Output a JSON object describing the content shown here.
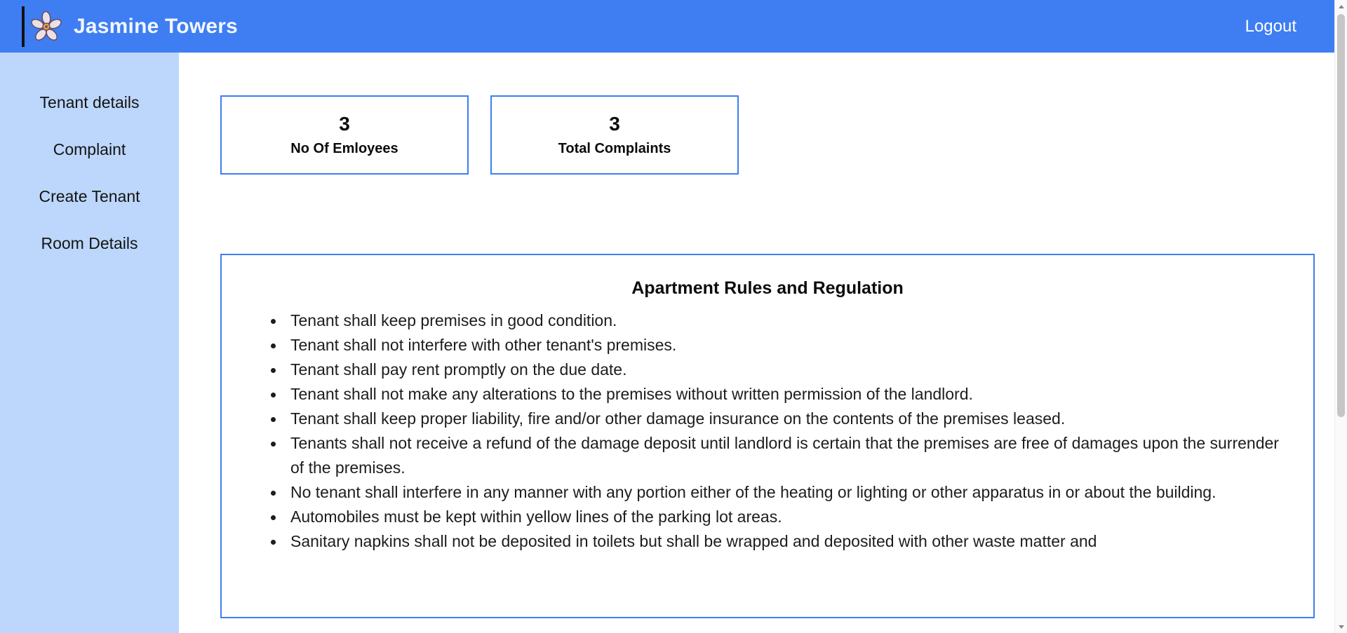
{
  "header": {
    "brand_title": "Jasmine Towers",
    "logo_icon": "jasmine-flower-icon",
    "logout_label": "Logout",
    "background_color": "#3e7ef2"
  },
  "sidebar": {
    "background_color": "#bcd7fb",
    "items": [
      {
        "label": "Tenant details"
      },
      {
        "label": "Complaint"
      },
      {
        "label": "Create Tenant"
      },
      {
        "label": "Room Details"
      }
    ]
  },
  "stats": {
    "accent_color": "#3e7ef2",
    "cards": [
      {
        "value": "3",
        "label": "No Of Emloyees"
      },
      {
        "value": "3",
        "label": "Total Complaints"
      }
    ]
  },
  "rules": {
    "title": "Apartment Rules and Regulation",
    "items": [
      "Tenant shall keep premises in good condition.",
      "Tenant shall not interfere with other tenant's premises.",
      "Tenant shall pay rent promptly on the due date.",
      "Tenant shall not make any alterations to the premises without written permission of the landlord.",
      "Tenant shall keep proper liability, fire and/or other damage insurance on the contents of the premises leased.",
      "Tenants shall not receive a refund of the damage deposit until landlord is certain that the premises are free of damages upon the surrender of the premises.",
      "No tenant shall interfere in any manner with any portion either of the heating or lighting or other apparatus in or about the building.",
      "Automobiles must be kept within yellow lines of the parking lot areas.",
      "Sanitary napkins shall not be deposited in toilets but shall be wrapped and deposited with other waste matter and"
    ]
  },
  "scrollbar": {
    "up_icon": "chevron-up-icon",
    "down_icon": "chevron-down-icon"
  }
}
